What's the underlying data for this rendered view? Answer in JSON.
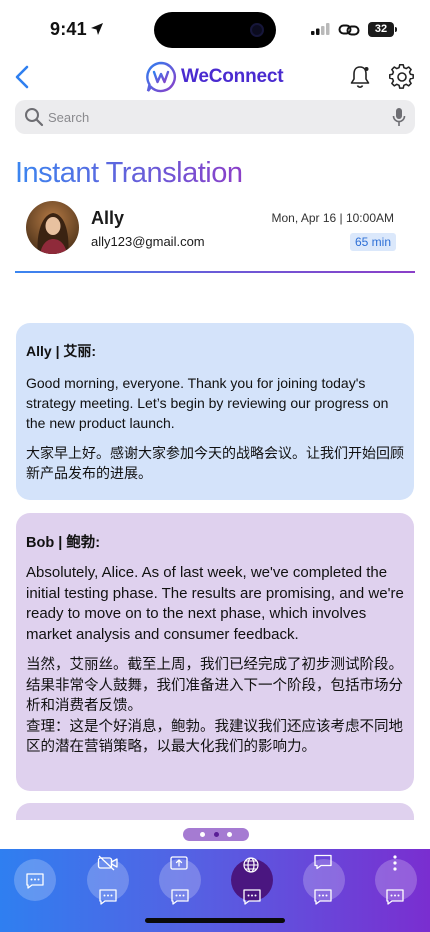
{
  "status_bar": {
    "time": "9:41",
    "battery": "32"
  },
  "header": {
    "app_name": "WeConnect"
  },
  "search": {
    "placeholder": "Search"
  },
  "page": {
    "title": "Instant Translation"
  },
  "contact": {
    "name": "Ally",
    "email": "ally123@gmail.com",
    "datetime": "Mon, Apr 16 | 10:00AM",
    "duration": "65 min"
  },
  "messages": [
    {
      "speaker": "Ally | 艾丽:",
      "english": "Good morning, everyone. Thank you for joining today's strategy meeting. Let’s begin by reviewing our progress on the new product launch.",
      "chinese": "大家早上好。感谢大家参加今天的战略会议。让我们开始回顾新产品发布的进展。"
    },
    {
      "speaker": "Bob | 鲍勃:",
      "english": "Absolutely, Alice. As of last week, we've completed the initial testing phase. The results are promising, and we're ready to move on to the next phase, which involves market analysis and consumer feedback.",
      "chinese": "当然，艾丽丝。截至上周，我们已经完成了初步测试阶段。结果非常令人鼓舞，我们准备进入下一个阶段，包括市场分析和消费者反馈。",
      "chinese_2": "查理：这是个好消息，鲍勃。我建议我们还应该考虑不同地区的潜在营销策略，以最大化我们的影响力。"
    }
  ],
  "pager": {
    "pages": 3,
    "active": 2
  },
  "bottom_nav": {
    "items": [
      {
        "icon": "chat-bubble-icon",
        "active": false
      },
      {
        "icon": "video-off-icon",
        "active": false
      },
      {
        "icon": "share-screen-icon",
        "active": false
      },
      {
        "icon": "globe-translate-icon",
        "active": true
      },
      {
        "icon": "message-icon",
        "active": false
      },
      {
        "icon": "more-vertical-icon",
        "active": false
      }
    ]
  },
  "colors": {
    "accent_blue": "#3a86f0",
    "accent_purple": "#8b3fc8",
    "ally_bubble": "#d4e3fa",
    "bob_bubble": "#dfd1ee"
  }
}
